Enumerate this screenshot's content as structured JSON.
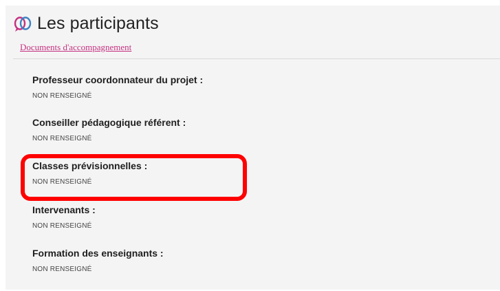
{
  "header": {
    "title": "Les participants",
    "logo_icon": "participants-logo-icon",
    "accent_color": "#c4317f"
  },
  "links": {
    "documents_label": "Documents d'accompagnement"
  },
  "fields": [
    {
      "label": "Professeur coordonnateur du projet :",
      "value": "NON RENSEIGNÉ"
    },
    {
      "label": "Conseiller pédagogique référent :",
      "value": "NON RENSEIGNÉ"
    },
    {
      "label": "Classes prévisionnelles :",
      "value": "NON RENSEIGNÉ"
    },
    {
      "label": "Intervenants :",
      "value": "NON RENSEIGNÉ"
    },
    {
      "label": "Formation des enseignants :",
      "value": "NON RENSEIGNÉ"
    }
  ],
  "highlight_color": "#ff0000"
}
